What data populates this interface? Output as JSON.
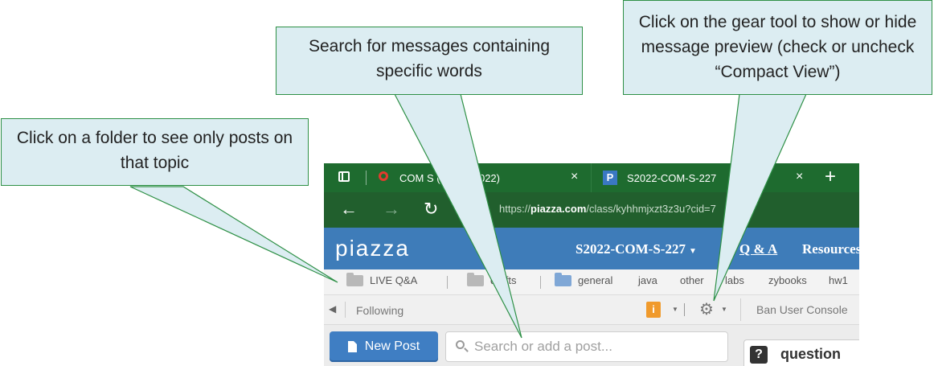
{
  "browser": {
    "tabs": [
      {
        "title": "COM S (Spring 2022)",
        "close": "×"
      },
      {
        "favicon": "P",
        "title": "S2022-COM-S-227",
        "close": "×"
      }
    ],
    "new_tab": "+",
    "url_prefix": "https://",
    "url_domain": "piazza.com",
    "url_rest": "/class/kyhhmjxzt3z3u?cid=7",
    "nav_icons": [
      "back-arrow-icon",
      "forward-arrow-icon",
      "reload-icon"
    ]
  },
  "piazza": {
    "logo": "piazza",
    "course": "S2022-COM-S-227",
    "nav_qa": "Q & A",
    "nav_resources": "Resources",
    "folders": [
      "LIVE Q&A",
      "drafts",
      "general",
      "java",
      "other",
      "labs",
      "zybooks",
      "hw1"
    ],
    "following": "Following",
    "info_icon": "i",
    "ban_user": "Ban User Console",
    "new_post": "New Post",
    "search_placeholder": "Search or add a post...",
    "question_label": "question",
    "question_icon": "?"
  },
  "callouts": {
    "folder": "Click on a folder to see only posts on that topic",
    "search": "Search for messages containing specific words",
    "gear": "Click on the gear tool to show or hide message preview (check or uncheck “Compact View”)"
  },
  "colors": {
    "browser_green": "#1e6b2f",
    "piazza_blue": "#3e7cb9",
    "callout_fill": "#dcedf2",
    "callout_border": "#2e9046"
  }
}
